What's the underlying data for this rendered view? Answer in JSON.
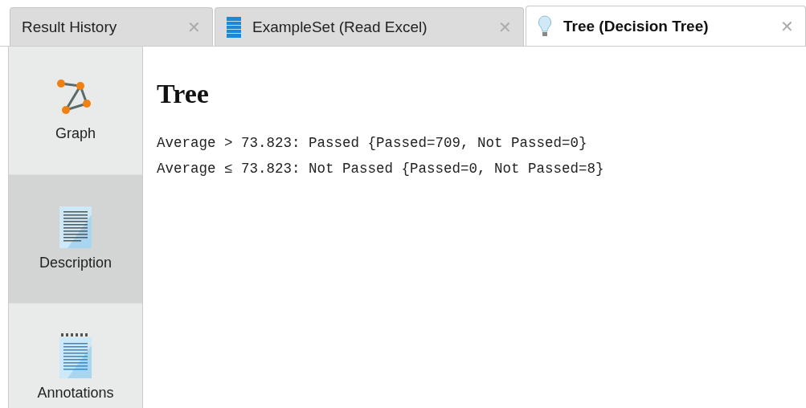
{
  "tabs": [
    {
      "label": "Result History",
      "kind": "plain",
      "close": "✕",
      "selected": false
    },
    {
      "label": "ExampleSet (Read Excel)",
      "kind": "table",
      "close": "✕",
      "selected": false
    },
    {
      "label": "Tree (Decision Tree)",
      "kind": "bulb",
      "close": "✕",
      "selected": true
    }
  ],
  "sidebar": {
    "items": [
      {
        "label": "Graph",
        "kind": "graph",
        "selected": false
      },
      {
        "label": "Description",
        "kind": "document",
        "selected": true
      },
      {
        "label": "Annotations",
        "kind": "notepad",
        "selected": false
      }
    ]
  },
  "content": {
    "title": "Tree",
    "lines": [
      "Average > 73.823: Passed {Passed=709, Not Passed=0}",
      "Average ≤ 73.823: Not Passed {Passed=0, Not Passed=8}"
    ]
  }
}
